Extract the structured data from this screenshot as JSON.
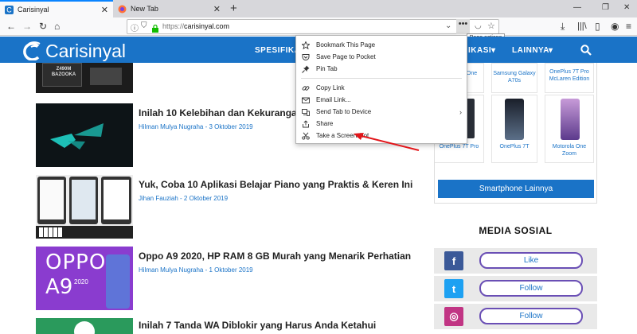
{
  "tabs": [
    {
      "title": "Carisinyal",
      "active": true
    },
    {
      "title": "New Tab",
      "active": false
    }
  ],
  "window": {
    "minimize": "—",
    "restore": "❐",
    "close": "✕"
  },
  "urlbar": {
    "scheme": "https://",
    "domain": "carisinyal.com",
    "tooltip": "Page actions"
  },
  "site": {
    "logo_text": "Carisinyal",
    "nav": [
      "SPESIFIKA",
      "IKASI",
      "LAINNYA"
    ],
    "brand_color": "#1a73c7"
  },
  "articles": [
    {
      "title": "Inilah 10 Kelebihan dan Kekurangan",
      "meta": "Hilman Mulya Nugraha - 3 Oktober 2019"
    },
    {
      "title": "Yuk, Coba 10 Aplikasi Belajar Piano yang Praktis & Keren Ini",
      "meta": "Jihan Fauziah - 2 Oktober 2019"
    },
    {
      "title": "Oppo A9 2020, HP RAM 8 GB Murah yang Menarik Perhatian",
      "meta": "Hilman Mulya Nugraha - 1 Oktober 2019"
    },
    {
      "title": "Inilah 7 Tanda WA Diblokir yang Harus Anda Ketahui",
      "meta": ""
    }
  ],
  "thumbs": {
    "mobo_label": "Z490M BAZOOKA",
    "oppo_text": "OPPO",
    "oppo_model": "A9",
    "oppo_year": "2020"
  },
  "page_actions_menu": [
    {
      "label": "Bookmark This Page",
      "icon": "star-icon"
    },
    {
      "label": "Save Page to Pocket",
      "icon": "pocket-icon"
    },
    {
      "label": "Pin Tab",
      "icon": "pin-icon"
    },
    {
      "label": "Copy Link",
      "icon": "link-icon"
    },
    {
      "label": "Email Link...",
      "icon": "email-icon"
    },
    {
      "label": "Send Tab to Device",
      "icon": "device-icon"
    },
    {
      "label": "Share",
      "icon": "share-icon"
    },
    {
      "label": "Take a Screenshot",
      "icon": "scissors-icon"
    }
  ],
  "phones": {
    "top": [
      "One",
      "Samsung Galaxy A70s",
      "OnePlus 7T Pro McLaren Edition"
    ],
    "bottom": [
      "OnePlus 7T Pro",
      "OnePlus 7T",
      "Motorola One Zoom"
    ]
  },
  "sidebar": {
    "more_button": "Smartphone Lainnya",
    "social_title": "MEDIA SOSIAL",
    "social": [
      {
        "network": "facebook",
        "label": "Like",
        "color": "#3b5998",
        "glyph": "f"
      },
      {
        "network": "twitter",
        "label": "Follow",
        "color": "#1da1f2",
        "glyph": "t"
      },
      {
        "network": "instagram",
        "label": "Follow",
        "color": "#c13584",
        "glyph": "◎"
      }
    ]
  }
}
